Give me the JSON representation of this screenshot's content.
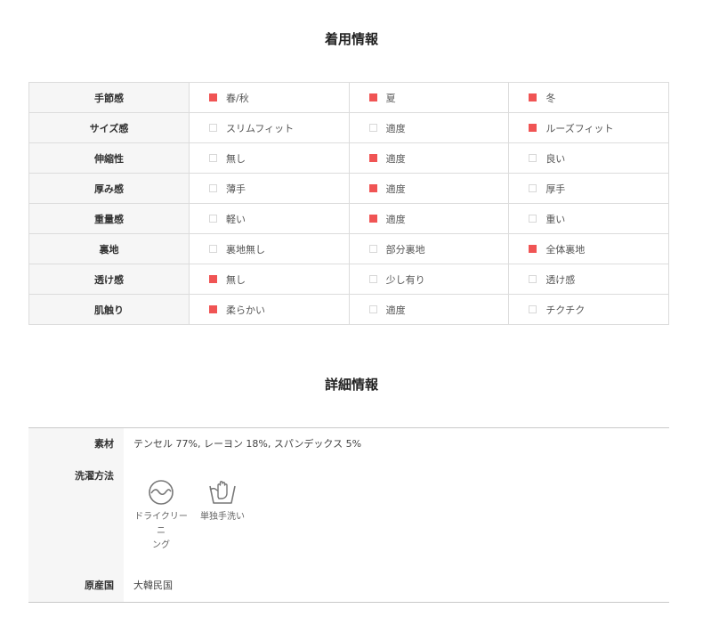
{
  "section1": {
    "title": "着用情報"
  },
  "fit_rows": [
    {
      "label": "手節感",
      "options": [
        {
          "text": "春/秋",
          "checked": true
        },
        {
          "text": "夏",
          "checked": true
        },
        {
          "text": "冬",
          "checked": true
        }
      ]
    },
    {
      "label": "サイズ感",
      "options": [
        {
          "text": "スリムフィット",
          "checked": false
        },
        {
          "text": "適度",
          "checked": false
        },
        {
          "text": "ルーズフィット",
          "checked": true
        }
      ]
    },
    {
      "label": "伸縮性",
      "options": [
        {
          "text": "無し",
          "checked": false
        },
        {
          "text": "適度",
          "checked": true
        },
        {
          "text": "良い",
          "checked": false
        }
      ]
    },
    {
      "label": "厚み感",
      "options": [
        {
          "text": "薄手",
          "checked": false
        },
        {
          "text": "適度",
          "checked": true
        },
        {
          "text": "厚手",
          "checked": false
        }
      ]
    },
    {
      "label": "重量感",
      "options": [
        {
          "text": "軽い",
          "checked": false
        },
        {
          "text": "適度",
          "checked": true
        },
        {
          "text": "重い",
          "checked": false
        }
      ]
    },
    {
      "label": "裏地",
      "options": [
        {
          "text": "裏地無し",
          "checked": false
        },
        {
          "text": "部分裏地",
          "checked": false
        },
        {
          "text": "全体裏地",
          "checked": true
        }
      ]
    },
    {
      "label": "透け感",
      "options": [
        {
          "text": "無し",
          "checked": true
        },
        {
          "text": "少し有り",
          "checked": false
        },
        {
          "text": "透け感",
          "checked": false
        }
      ]
    },
    {
      "label": "肌触り",
      "options": [
        {
          "text": "柔らかい",
          "checked": true
        },
        {
          "text": "適度",
          "checked": false
        },
        {
          "text": "チクチク",
          "checked": false
        }
      ]
    }
  ],
  "section2": {
    "title": "詳細情報"
  },
  "details": {
    "material_label": "素材",
    "material_value": "テンセル 77%, レーヨン 18%, スパンデックス 5%",
    "washing_label": "洗濯方法",
    "wash_items": [
      {
        "icon": "dry-clean-icon",
        "line1": "ドライクリーニ",
        "line2": "ング"
      },
      {
        "icon": "hand-wash-icon",
        "line1": "単独手洗い",
        "line2": ""
      }
    ],
    "origin_label": "原産国",
    "origin_value": "大韓民国"
  },
  "colors": {
    "accent": "#f05454",
    "border": "#dcdcdc",
    "label_bg": "#f6f6f6"
  }
}
